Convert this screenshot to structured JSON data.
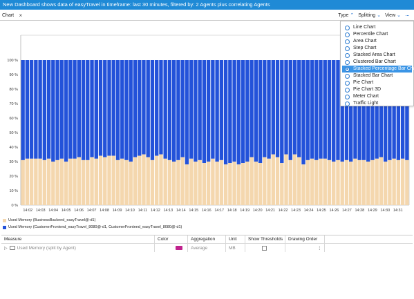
{
  "titlebar": {
    "text": "New Dashboard shows data of easyTravel in timeframe: last 30 minutes, filtered by: 2 Agents plus correlating Agents"
  },
  "tab": {
    "label": "Chart",
    "close_glyph": "×"
  },
  "toolbar": {
    "type_label": "Type",
    "splitting_label": "Splitting",
    "view_label": "View",
    "more_glyph": "···"
  },
  "chart_type_menu": {
    "items": [
      "Line Chart",
      "Percentile Chart",
      "Area Chart",
      "Step Chart",
      "Stacked Area Chart",
      "Clustered Bar Chart",
      "Stacked Percentage Bar Chart",
      "Stacked Bar Chart",
      "Pie Chart",
      "Pie Chart 3D",
      "Meter Chart",
      "Traffic Light"
    ],
    "selected": "Stacked Percentage Bar Chart"
  },
  "chart_data": {
    "type": "bar",
    "stacked": true,
    "percentage": true,
    "ylim": [
      0,
      100
    ],
    "yticks": [
      "0 %",
      "10 %",
      "20 %",
      "30 %",
      "40 %",
      "50 %",
      "60 %",
      "70 %",
      "80 %",
      "90 %",
      "100 %"
    ],
    "xticks": [
      "14:02",
      "14:03",
      "14:04",
      "14:05",
      "14:06",
      "14:07",
      "14:08",
      "14:09",
      "14:10",
      "14:11",
      "14:12",
      "14:13",
      "14:14",
      "14:15",
      "14:16",
      "14:17",
      "14:18",
      "14:19",
      "14:20",
      "14:21",
      "14:22",
      "14:23",
      "14:24",
      "14:25",
      "14:26",
      "14:27",
      "14:28",
      "14:29",
      "14:30",
      "14:31"
    ],
    "series": [
      {
        "name": "Used Memory (BusinessBackend_easyTravel@-d1)",
        "color": "#f4d7ae",
        "values": [
          31,
          32,
          32,
          32,
          32,
          31,
          32,
          30,
          31,
          32,
          30,
          32,
          32,
          33,
          31,
          31,
          33,
          32,
          34,
          33,
          34,
          34,
          31,
          32,
          31,
          30,
          33,
          34,
          35,
          33,
          31,
          34,
          35,
          32,
          31,
          30,
          31,
          33,
          28,
          32,
          30,
          31,
          29,
          30,
          32,
          30,
          31,
          28,
          29,
          30,
          28,
          29,
          30,
          33,
          30,
          29,
          33,
          32,
          35,
          33,
          29,
          35,
          31,
          35,
          33,
          28,
          31,
          32,
          31,
          32,
          32,
          31,
          30,
          31,
          30,
          31,
          30,
          32,
          31,
          31,
          30,
          31,
          32,
          33,
          30,
          31,
          32,
          31,
          32,
          31
        ]
      },
      {
        "name": "Used Memory (CustomerFrontend_easyTravel_8080@-d1, CustomerFrontend_easyTravel_8080@-d1)",
        "color": "#2352d9",
        "values": "complement to 100 %"
      }
    ]
  },
  "legend": {
    "items": [
      {
        "label": "Used Memory (BusinessBackend_easyTravel@-d1)",
        "color": "#f4d7ae"
      },
      {
        "label": "Used Memory (CustomerFrontend_easyTravel_8080@-d1, CustomerFrontend_easyTravel_8080@-d1)",
        "color": "#2352d9"
      }
    ]
  },
  "measures_table": {
    "headers": {
      "measure": "Measure",
      "color": "Color",
      "aggregation": "Aggregation",
      "unit": "Unit",
      "thresholds": "Show Thresholds",
      "order": "Drawing Order"
    },
    "rows": [
      {
        "measure": "Used Memory (split by Agent)",
        "color": "#c0228e",
        "aggregation": "Average",
        "unit": "MB",
        "show_thresholds": false
      }
    ]
  }
}
